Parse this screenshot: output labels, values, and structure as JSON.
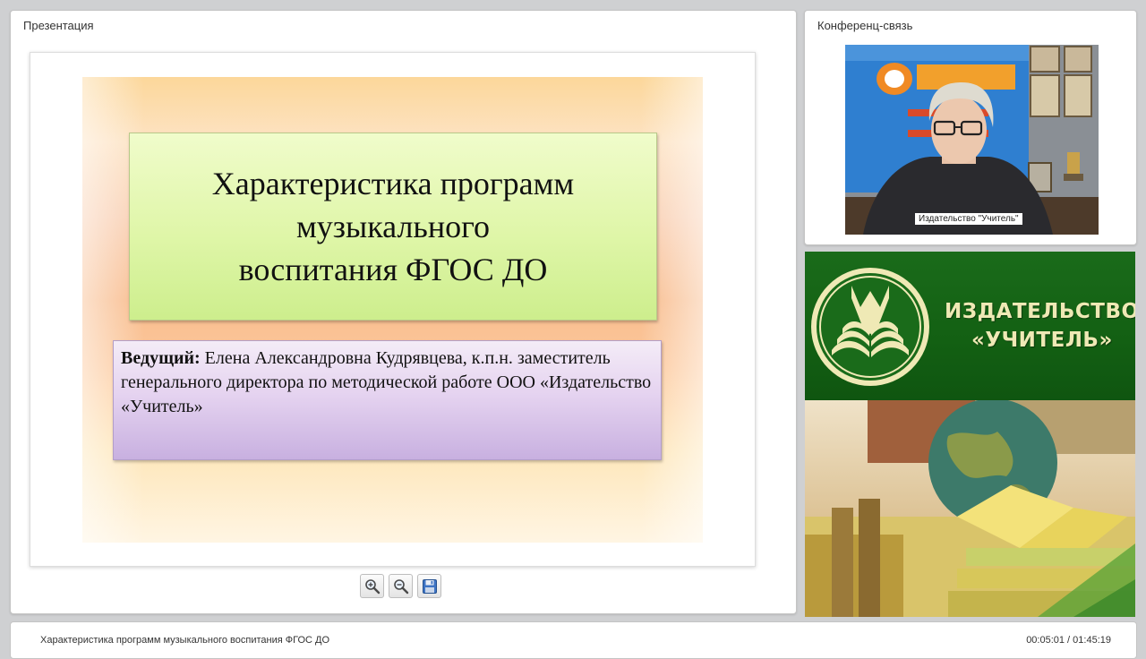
{
  "presentation_panel": {
    "title": "Презентация",
    "slide": {
      "title": "Характеристика программ\nмузыкального\nвоспитания ФГОС ДО",
      "presenter_label": "Ведущий:",
      "presenter_text": " Елена Александровна Кудрявцева, к.п.н. заместитель генерального директора по методической работе ООО «Издательство «Учитель»"
    },
    "toolbar": {
      "zoom_in_icon": "zoom-in-icon",
      "zoom_out_icon": "zoom-out-icon",
      "save_icon": "floppy-disk-icon"
    }
  },
  "conference_panel": {
    "title": "Конференц-связь",
    "video_label": "Издательство \"Учитель\""
  },
  "promo": {
    "line1": "ИЗДАТЕЛЬСТВО",
    "line2": "«УЧИТЕЛЬ»"
  },
  "status_bar": {
    "title": "Характеристика программ музыкального воспитания ФГОС ДО",
    "time": "00:05:01 / 01:45:19"
  },
  "colors": {
    "background": "#cfd0d2",
    "promo_green": "#136013",
    "promo_text": "#efe9b5"
  }
}
